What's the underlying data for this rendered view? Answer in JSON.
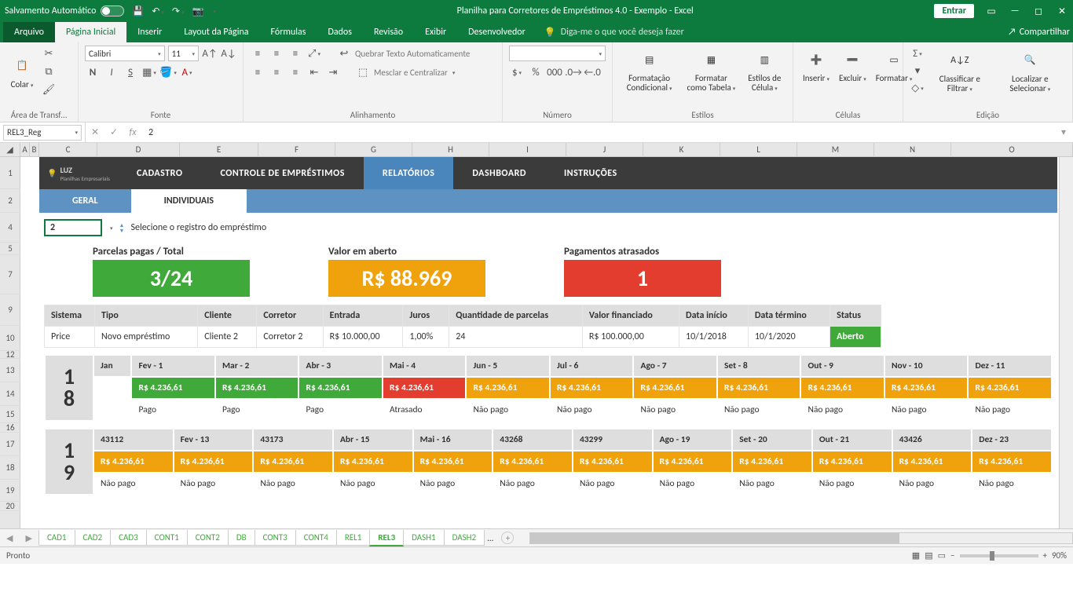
{
  "titlebar": {
    "autosave": "Salvamento Automático",
    "title": "Planilha para Corretores de Empréstimos 4.0 - Exemplo  -  Excel",
    "signin": "Entrar"
  },
  "tabs": {
    "file": "Arquivo",
    "home": "Página Inicial",
    "insert": "Inserir",
    "layout": "Layout da Página",
    "formulas": "Fórmulas",
    "data": "Dados",
    "review": "Revisão",
    "view": "Exibir",
    "dev": "Desenvolvedor",
    "tellme": "Diga-me o que você deseja fazer",
    "share": "Compartilhar"
  },
  "ribbon": {
    "clipboard": "Área de Transf…",
    "paste": "Colar",
    "font_group": "Fonte",
    "font_name": "Calibri",
    "font_size": "11",
    "alignment": "Alinhamento",
    "wrap": "Quebrar Texto Automaticamente",
    "merge": "Mesclar e Centralizar",
    "number": "Número",
    "styles": "Estilos",
    "cond_fmt": "Formatação Condicional",
    "as_table": "Formatar como Tabela",
    "cell_styles": "Estilos de Célula",
    "cells": "Células",
    "insert_btn": "Inserir",
    "delete_btn": "Excluir",
    "format_btn": "Formatar",
    "editing": "Edição",
    "sort": "Classificar e Filtrar",
    "find": "Localizar e Selecionar"
  },
  "formula": {
    "namebox": "REL3_Reg",
    "value": "2"
  },
  "cols": [
    "A",
    "B",
    "C",
    "D",
    "E",
    "F",
    "G",
    "H",
    "I",
    "J",
    "K",
    "L",
    "M",
    "N",
    "O"
  ],
  "rownums": [
    "1",
    "2",
    "4",
    "5",
    "7",
    "9",
    "10",
    "12",
    "13",
    "14",
    "15",
    "16",
    "17",
    "18",
    "19",
    "20"
  ],
  "wbnav": {
    "logo1": "LUZ",
    "logo2": "Planilhas Empresariais",
    "cadastro": "CADASTRO",
    "controle": "CONTROLE DE EMPRÉSTIMOS",
    "relatorios": "RELATÓRIOS",
    "dashboard": "DASHBOARD",
    "instrucoes": "INSTRUÇÕES"
  },
  "subnav": {
    "geral": "GERAL",
    "indiv": "INDIVIDUAIS"
  },
  "reg": {
    "value": "2",
    "label": "Selecione o registro do empréstimo"
  },
  "metrics": {
    "m1l": "Parcelas pagas / Total",
    "m1v": "3/24",
    "m2l": "Valor em aberto",
    "m2v": "R$ 88.969",
    "m3l": "Pagamentos atrasados",
    "m3v": "1"
  },
  "loanhead": {
    "sistema": "Sistema",
    "tipo": "Tipo",
    "cliente": "Cliente",
    "corretor": "Corretor",
    "entrada": "Entrada",
    "juros": "Juros",
    "qparc": "Quantidade de parcelas",
    "valorfin": "Valor financiado",
    "dini": "Data início",
    "dfim": "Data término",
    "status": "Status"
  },
  "loan": {
    "sistema": "Price",
    "tipo": "Novo empréstimo",
    "cliente": "Cliente 2",
    "corretor": "Corretor 2",
    "entrada": "R$ 10.000,00",
    "juros": "1,00%",
    "qparc": "24",
    "valorfin": "R$ 100.000,00",
    "dini": "10/1/2018",
    "dfim": "10/1/2020",
    "status": "Aberto"
  },
  "sched_value": "R$ 4.236,61",
  "status_pago": "Pago",
  "status_atraso": "Atrasado",
  "status_npago": "Não pago",
  "y18": {
    "year": "18",
    "m": [
      "Jan",
      "Fev - 1",
      "Mar - 2",
      "Abr - 3",
      "Mai - 4",
      "Jun - 5",
      "Jul - 6",
      "Ago - 7",
      "Set - 8",
      "Out - 9",
      "Nov - 10",
      "Dez - 11"
    ]
  },
  "y19": {
    "year": "19",
    "m": [
      "43112",
      "Fev - 13",
      "43173",
      "Abr - 15",
      "Mai - 16",
      "43268",
      "43299",
      "Ago - 19",
      "Set - 20",
      "Out - 21",
      "43426",
      "Dez - 23"
    ]
  },
  "sheettabs": [
    "CAD1",
    "CAD2",
    "CAD3",
    "CONT1",
    "CONT2",
    "DB",
    "CONT3",
    "CONT4",
    "REL1",
    "REL3",
    "DASH1",
    "DASH2"
  ],
  "sheettab_more": "...",
  "status": {
    "ready": "Pronto",
    "zoom": "90%"
  }
}
